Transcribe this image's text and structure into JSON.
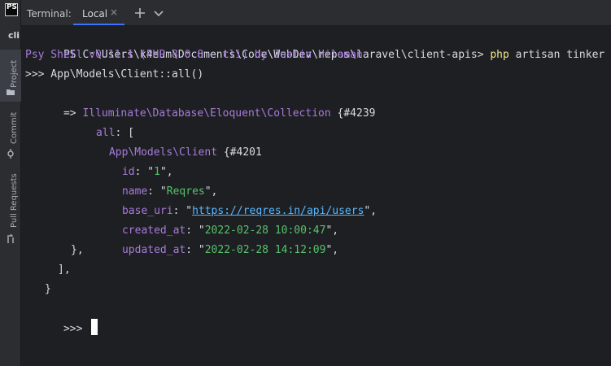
{
  "app": {
    "logo_text": "PS",
    "sidebar_cli": "cli"
  },
  "sidebar": {
    "items": [
      {
        "label": "Project",
        "icon": "folder-icon"
      },
      {
        "label": "Commit",
        "icon": "commit-icon"
      },
      {
        "label": "Pull Requests",
        "icon": "pull-request-icon"
      }
    ]
  },
  "topbar": {
    "terminal_label": "Terminal:",
    "tab_label": "Local",
    "close_symbol": "×",
    "add_symbol": "+",
    "dropdown_symbol": "⌄"
  },
  "terminal": {
    "lines": [
      {
        "prompt": "PS C:\\Users\\k4eum\\Documents\\Code\\WebDev\\repos\\laravel\\client-apis> ",
        "command": "php",
        "args": " artisan tinker"
      },
      {
        "text": "Psy Shell v0.11.1 (PHP 8.0.8 — cli) by Justin Hileman"
      },
      {
        "text": ">>> App\\Models\\Client::all()"
      },
      {
        "prefix": "=> ",
        "class_name": "Illuminate\\Database\\Eloquent\\Collection",
        "suffix": " {#4239"
      },
      {
        "key": "all",
        "rest": ": ["
      },
      {
        "class_name": "App\\Models\\Client",
        "suffix": " {#4201"
      },
      {
        "key": "id",
        "sep": ": \"",
        "value": "1",
        "end": "\","
      },
      {
        "key": "name",
        "sep": ": \"",
        "value": "Reqres",
        "end": "\","
      },
      {
        "key": "base_uri",
        "sep": ": \"",
        "value": "https://reqres.in/api/users",
        "end": "\","
      },
      {
        "key": "created_at",
        "sep": ": \"",
        "value": "2022-02-28 10:00:47",
        "end": "\","
      },
      {
        "key": "updated_at",
        "sep": ": \"",
        "value": "2022-02-28 14:12:09",
        "end": "\","
      },
      {
        "text": "},"
      },
      {
        "text": "],"
      },
      {
        "text": "}"
      },
      {
        "prompt": ">>> "
      }
    ]
  },
  "colors": {
    "background": "#1e1f22",
    "accent": "#3c74ff",
    "purple": "#a77bdb",
    "green": "#56c26b",
    "yellow": "#f0e68c",
    "url": "#58b7ff"
  }
}
